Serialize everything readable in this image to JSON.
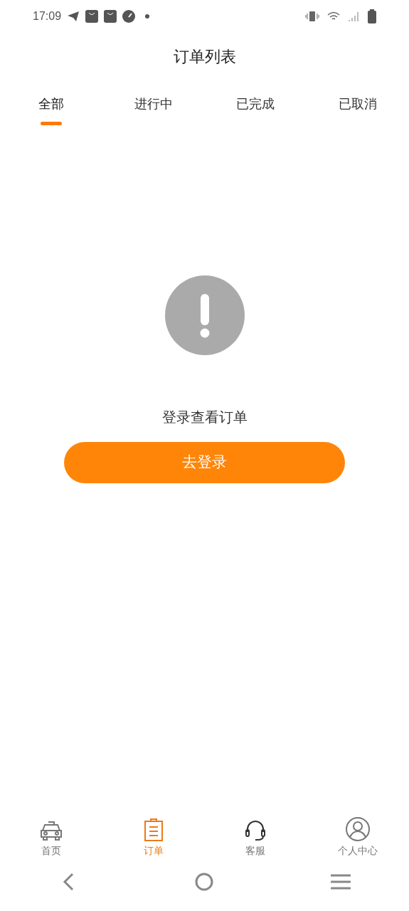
{
  "status_bar": {
    "time": "17:09"
  },
  "header": {
    "title": "订单列表"
  },
  "tabs": [
    {
      "label": "全部",
      "selected": true
    },
    {
      "label": "进行中",
      "selected": false
    },
    {
      "label": "已完成",
      "selected": false
    },
    {
      "label": "已取消",
      "selected": false
    }
  ],
  "empty_state": {
    "message": "登录查看订单",
    "button": "去登录"
  },
  "bottom_nav": [
    {
      "kind": "taxi",
      "label": "首页",
      "selected": false
    },
    {
      "kind": "clipboard",
      "label": "订单",
      "selected": true
    },
    {
      "kind": "headset",
      "label": "客服",
      "selected": false
    },
    {
      "kind": "user",
      "label": "个人中心",
      "selected": false
    }
  ]
}
